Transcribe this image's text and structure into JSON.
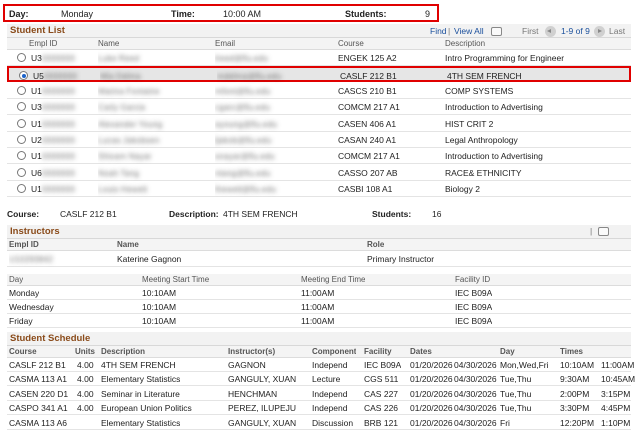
{
  "header": {
    "day_label": "Day:",
    "day_value": "Monday",
    "time_label": "Time:",
    "time_value": "10:00 AM",
    "students_label": "Students:",
    "students_value": "9"
  },
  "student_list": {
    "title": "Student List",
    "nav": {
      "find": "Find",
      "view_all": "View All",
      "first": "First",
      "range": "1-9 of 9",
      "last": "Last"
    },
    "columns": [
      "Empl ID",
      "Name",
      "Email",
      "Course",
      "Description"
    ],
    "rows": [
      {
        "selected": false,
        "empl_id": "U3",
        "name": "Luke Reed",
        "email": "lreed@fiu.edu",
        "course": "ENGEK 125 A2",
        "description": "Intro Programming for Engineer"
      },
      {
        "selected": true,
        "empl_id": "U5",
        "name": "Mia Delma",
        "email": "mdelma@fiu.edu",
        "course": "CASLF 212 B1",
        "description": "4TH SEM FRENCH"
      },
      {
        "selected": false,
        "empl_id": "U1",
        "name": "Marina Fontaine",
        "email": "mfont@fiu.edu",
        "course": "CASCS 210 B1",
        "description": "COMP SYSTEMS"
      },
      {
        "selected": false,
        "empl_id": "U3",
        "name": "Carly Garcia",
        "email": "cgarc@fiu.edu",
        "course": "COMCM 217 A1",
        "description": "Introduction to Advertising"
      },
      {
        "selected": false,
        "empl_id": "U1",
        "name": "Alexander Young",
        "email": "ayoung@fiu.edu",
        "course": "CASEN 406 A1",
        "description": "HIST CRIT 2"
      },
      {
        "selected": false,
        "empl_id": "U2",
        "name": "Lucas Jakobsen",
        "email": "ljakob@fiu.edu",
        "course": "CASAN 240 A1",
        "description": "Legal Anthropology"
      },
      {
        "selected": false,
        "empl_id": "U1",
        "name": "Shivam Nayar",
        "email": "snayar@fiu.edu",
        "course": "COMCM 217 A1",
        "description": "Introduction to Advertising"
      },
      {
        "selected": false,
        "empl_id": "U6",
        "name": "Noah Tang",
        "email": "ntang@fiu.edu",
        "course": "CASSO 207 AB",
        "description": "RACE& ETHNICITY"
      },
      {
        "selected": false,
        "empl_id": "U1",
        "name": "Louis Hewett",
        "email": "lhewett@fiu.edu",
        "course": "CASBI 108 A1",
        "description": "Biology 2"
      }
    ]
  },
  "course_summary": {
    "course_label": "Course:",
    "course_value": "CASLF 212 B1",
    "description_label": "Description:",
    "description_value": "4TH SEM FRENCH",
    "students_label": "Students:",
    "students_value": "16"
  },
  "instructors": {
    "title": "Instructors",
    "columns": [
      "Empl ID",
      "Name",
      "Role"
    ],
    "rows": [
      {
        "empl_id": "U10293842",
        "name": "Katerine Gagnon",
        "role": "Primary Instructor"
      }
    ]
  },
  "meetings": {
    "columns": [
      "Day",
      "Meeting Start Time",
      "Meeting End Time",
      "Facility ID"
    ],
    "rows": [
      {
        "day": "Monday",
        "start": "10:10AM",
        "end": "11:00AM",
        "facility": "IEC B09A"
      },
      {
        "day": "Wednesday",
        "start": "10:10AM",
        "end": "11:00AM",
        "facility": "IEC B09A"
      },
      {
        "day": "Friday",
        "start": "10:10AM",
        "end": "11:00AM",
        "facility": "IEC B09A"
      }
    ]
  },
  "schedule": {
    "title": "Student Schedule",
    "columns": [
      "Course",
      "Units",
      "Description",
      "Instructor(s)",
      "Component",
      "Facility",
      "Dates",
      "",
      "Day",
      "Times",
      ""
    ],
    "rows": [
      {
        "course": "CASLF 212 B1",
        "units": "4.00",
        "description": "4TH SEM FRENCH",
        "instructor": "GAGNON",
        "component": "Independ",
        "facility": "IEC B09A",
        "start": "01/20/2026",
        "end": "04/30/2026",
        "day": "Mon,Wed,Fri",
        "t1": "10:10AM",
        "t2": "11:00AM"
      },
      {
        "course": "CASMA 113 A1",
        "units": "4.00",
        "description": "Elementary Statistics",
        "instructor": "GANGULY, XUAN",
        "component": "Lecture",
        "facility": "CGS 511",
        "start": "01/20/2026",
        "end": "04/30/2026",
        "day": "Tue,Thu",
        "t1": "9:30AM",
        "t2": "10:45AM"
      },
      {
        "course": "CASEN 220 D1",
        "units": "4.00",
        "description": "Seminar in Literature",
        "instructor": "HENCHMAN",
        "component": "Independ",
        "facility": "CAS 227",
        "start": "01/20/2026",
        "end": "04/30/2026",
        "day": "Tue,Thu",
        "t1": "2:00PM",
        "t2": "3:15PM"
      },
      {
        "course": "CASPO 341 A1",
        "units": "4.00",
        "description": "European Union Politics",
        "instructor": "PEREZ, ILUPEJU",
        "component": "Independ",
        "facility": "CAS 226",
        "start": "01/20/2026",
        "end": "04/30/2026",
        "day": "Tue,Thu",
        "t1": "3:30PM",
        "t2": "4:45PM"
      },
      {
        "course": "CASMA 113 A6",
        "units": "",
        "description": "Elementary Statistics",
        "instructor": "GANGULY, XUAN",
        "component": "Discussion",
        "facility": "BRB 121",
        "start": "01/20/2026",
        "end": "04/30/2026",
        "day": "Fri",
        "t1": "12:20PM",
        "t2": "1:10PM"
      }
    ]
  },
  "colors": {
    "highlight_border": "#e00000",
    "section_title": "#8a4b1a",
    "link": "#1a4f9c",
    "selected_row": "#e6e6e6"
  }
}
